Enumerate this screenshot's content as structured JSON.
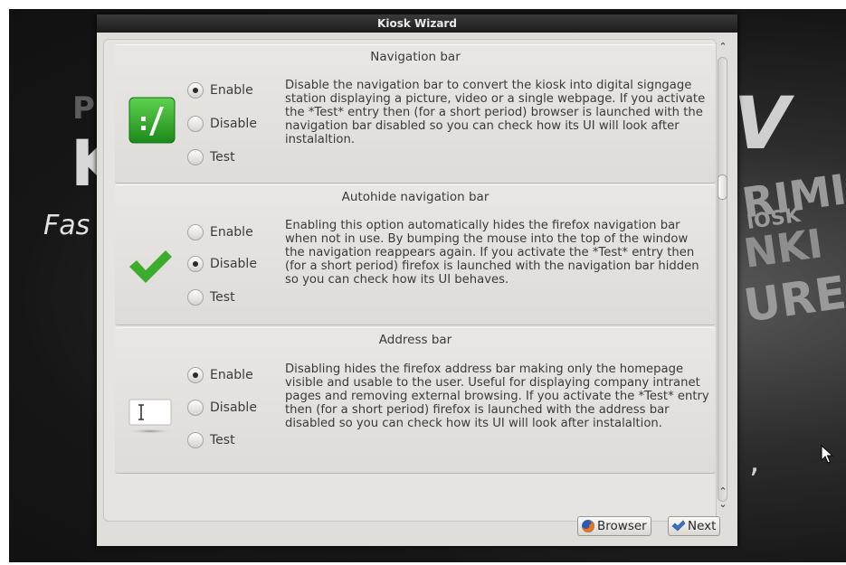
{
  "window": {
    "title": "Kiosk Wizard"
  },
  "background": {
    "letter_p": "P",
    "letter_k": "K",
    "tagline_fragment": "Fas",
    "letter_v": "V",
    "right_line1": "RIMI",
    "right_line2": "IOSK",
    "right_line3": "NKI",
    "right_line4": "URE",
    "comma": ","
  },
  "sections": [
    {
      "title": "Navigation bar",
      "icon": "terminal-green-icon",
      "options": [
        "Enable",
        "Disable",
        "Test"
      ],
      "selected": "Enable",
      "description": "Disable the navigation bar to convert the kiosk into digital signgage station displaying a picture, video or a single webpage. If you activate the *Test* entry then (for a short period) browser is launched with the navigation bar disabled so you can check how its UI will look after instalaltion."
    },
    {
      "title": "Autohide navigation bar",
      "icon": "checkmark-icon",
      "options": [
        "Enable",
        "Disable",
        "Test"
      ],
      "selected": "Disable",
      "description": "Enabling this option automatically hides the firefox navigation bar when not in use. By bumping the mouse into the top of the window the navigation reappears again. If you activate the *Test* entry then (for a short period) firefox is launched with the navigation bar hidden so you can check how its UI behaves."
    },
    {
      "title": "Address bar",
      "icon": "text-field-icon",
      "options": [
        "Enable",
        "Disable",
        "Test"
      ],
      "selected": "Enable",
      "description": "Disabling hides the firefox address bar making only the homepage visible and usable to the user. Useful for displaying company intranet pages and removing external browsing. If you activate the *Test* entry then (for a short period) firefox is launched with the address bar disabled so you can check how its UI will look after instalaltion."
    }
  ],
  "scrollbar": {
    "up_arrow": "⌃",
    "down_arrow": "⌄",
    "position_fraction": 0.28
  },
  "buttons": {
    "browser": "Browser",
    "next": "Next"
  },
  "colors": {
    "terminal_green": "#2fa32a",
    "check_green": "#3cac2c",
    "titlebar": "#2a2a2a"
  }
}
